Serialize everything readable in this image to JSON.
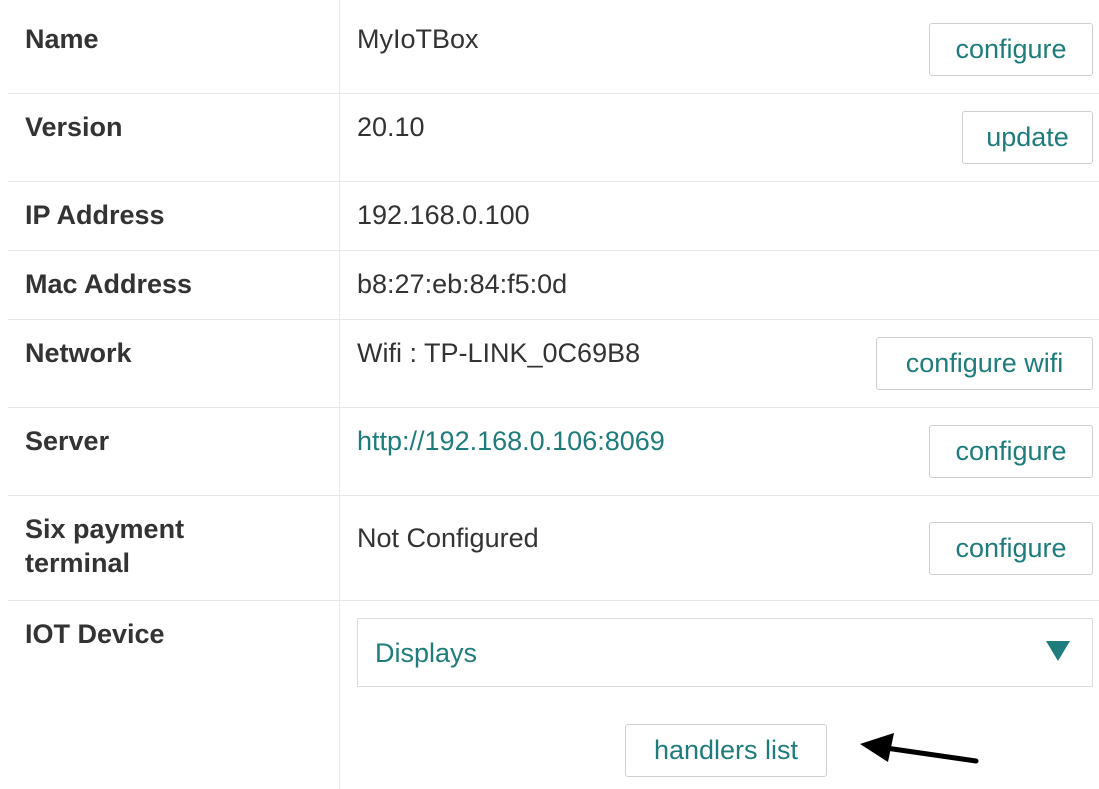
{
  "rows": [
    {
      "label": "Name",
      "value": "MyIoTBox",
      "button": "configure"
    },
    {
      "label": "Version",
      "value": "20.10",
      "button": "update"
    },
    {
      "label": "IP Address",
      "value": "192.168.0.100"
    },
    {
      "label": "Mac Address",
      "value": "b8:27:eb:84:f5:0d"
    },
    {
      "label": "Network",
      "value": "Wifi : TP-LINK_0C69B8",
      "button": "configure wifi"
    },
    {
      "label": "Server",
      "value": "http://192.168.0.106:8069",
      "button": "configure"
    },
    {
      "label_line1": "Six payment",
      "label_line2": "terminal",
      "value": "Not Configured",
      "button": "configure"
    },
    {
      "label": "IOT Device",
      "select_value": "Displays",
      "button": "handlers list"
    }
  ],
  "icons": {
    "dropdown": "triangle-down-icon",
    "annotation": "arrow-left-icon"
  },
  "colors": {
    "accent": "#1f7c7c",
    "text": "#333333",
    "border": "#cfcfcf"
  }
}
